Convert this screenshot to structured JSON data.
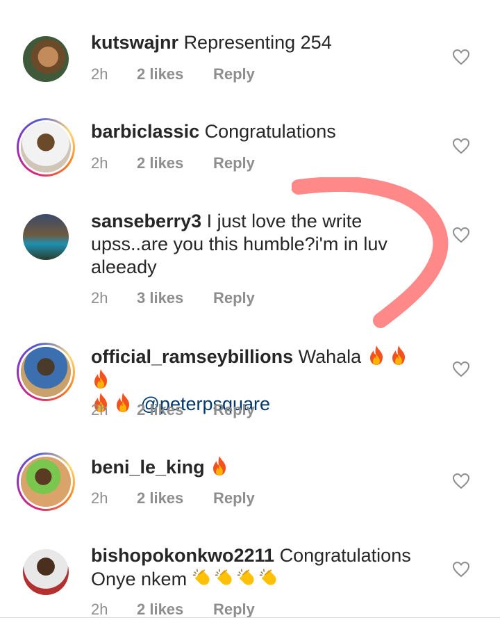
{
  "colors": {
    "username": "#262626",
    "meta": "#8e8e8e",
    "mention": "#00376b",
    "annotation_stroke": "#ff7b7b"
  },
  "comments": [
    {
      "username": "kutswajnr",
      "text": "Representing 254",
      "time": "2h",
      "likes": "2 likes",
      "reply": "Reply",
      "story_ring": false
    },
    {
      "username": "barbiclassic",
      "text": "Congratulations",
      "time": "2h",
      "likes": "2 likes",
      "reply": "Reply",
      "story_ring": true
    },
    {
      "username": "sanseberry3",
      "text": "I just love the write upss..are you this humble?i'm in luv aleeady",
      "time": "2h",
      "likes": "3 likes",
      "reply": "Reply",
      "story_ring": false
    },
    {
      "username": "official_ramseybillions",
      "text": "Wahala",
      "emojis": [
        "fire",
        "fire",
        "fire",
        "fire",
        "fire"
      ],
      "mention": "@peterpsquare",
      "time": "2h",
      "likes": "2 likes",
      "reply": "Reply",
      "story_ring": true
    },
    {
      "username": "beni_le_king",
      "text": "",
      "emojis": [
        "fire"
      ],
      "time": "2h",
      "likes": "2 likes",
      "reply": "Reply",
      "story_ring": true
    },
    {
      "username": "bishopokonkwo2211",
      "text": "Congratulations Onye nkem",
      "emojis": [
        "clapping-hands",
        "clapping-hands",
        "clapping-hands",
        "clapping-hands"
      ],
      "time": "2h",
      "likes": "2 likes",
      "reply": "Reply",
      "story_ring": false
    }
  ],
  "icons": {
    "like": "heart-outline-icon",
    "fire": "fire-emoji",
    "clap": "clapping-hands-emoji"
  }
}
